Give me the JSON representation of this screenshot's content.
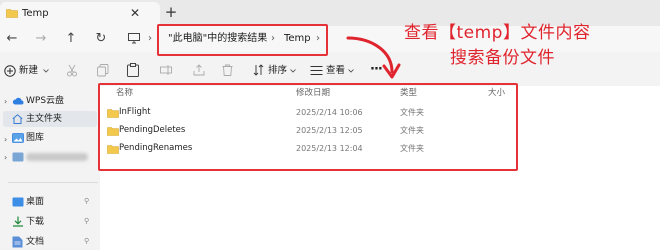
{
  "window": {
    "tab_title": "Temp",
    "close_glyph": "✕",
    "add_glyph": "+"
  },
  "nav": {
    "back_glyph": "←",
    "forward_glyph": "→",
    "up_glyph": "↑",
    "refresh_glyph": "↻",
    "breadcrumbs": [
      "\"此电脑\"中的搜索结果",
      "Temp"
    ],
    "sep_glyph": "›"
  },
  "commandbar": {
    "new_label": "新建",
    "sort_label": "排序",
    "view_label": "查看",
    "more_glyph": "···"
  },
  "sidebar": {
    "items": [
      {
        "label": "WPS云盘",
        "icon": "cloud-icon"
      },
      {
        "label": "主文件夹",
        "icon": "home-icon"
      },
      {
        "label": "图库",
        "icon": "gallery-icon"
      },
      {
        "label": "",
        "icon": "blurred-user-icon"
      },
      {
        "label": "桌面",
        "icon": "desktop-icon"
      },
      {
        "label": "下载",
        "icon": "download-icon"
      },
      {
        "label": "文档",
        "icon": "document-icon"
      }
    ],
    "pin_glyph": "📌"
  },
  "content": {
    "columns": {
      "name": "名称",
      "modified": "修改日期",
      "type": "类型",
      "size": "大小"
    },
    "rows": [
      {
        "name": "InFlight",
        "modified": "2025/2/14 10:06",
        "type": "文件夹"
      },
      {
        "name": "PendingDeletes",
        "modified": "2025/2/13 12:05",
        "type": "文件夹"
      },
      {
        "name": "PendingRenames",
        "modified": "2025/2/13 12:04",
        "type": "文件夹"
      }
    ]
  },
  "annotation": {
    "line1": "查看【temp】文件内容",
    "line2": "搜索备份文件",
    "color": "#e0242d"
  }
}
